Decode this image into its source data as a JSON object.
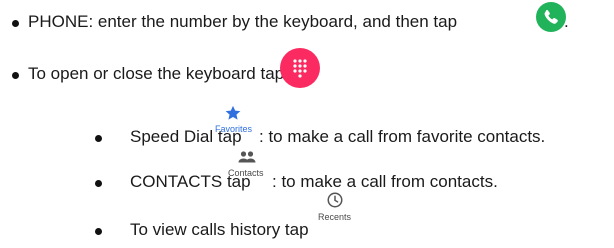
{
  "items": [
    {
      "text": "PHONE: enter the number by the keyboard, and then tap",
      "trailing_text": ".",
      "icon": "phone-icon",
      "icon_color": "#21b35a"
    },
    {
      "text": "To open or close the keyboard tap",
      "icon": "dialpad-icon",
      "icon_color": "#fb2a60"
    }
  ],
  "subitems": [
    {
      "prefix": "Speed Dial tap",
      "icon": "star-icon",
      "icon_color": "#2f6fe0",
      "icon_label": "Favorites",
      "icon_label_color": "#2f6fe0",
      "suffix": ": to make a call from favorite contacts."
    },
    {
      "prefix": "CONTACTS tap",
      "icon": "people-icon",
      "icon_label": "Contacts",
      "suffix": ": to make a call from contacts."
    },
    {
      "prefix": "To view calls history tap",
      "icon": "clock-icon",
      "icon_label": "Recents",
      "suffix": ""
    }
  ]
}
